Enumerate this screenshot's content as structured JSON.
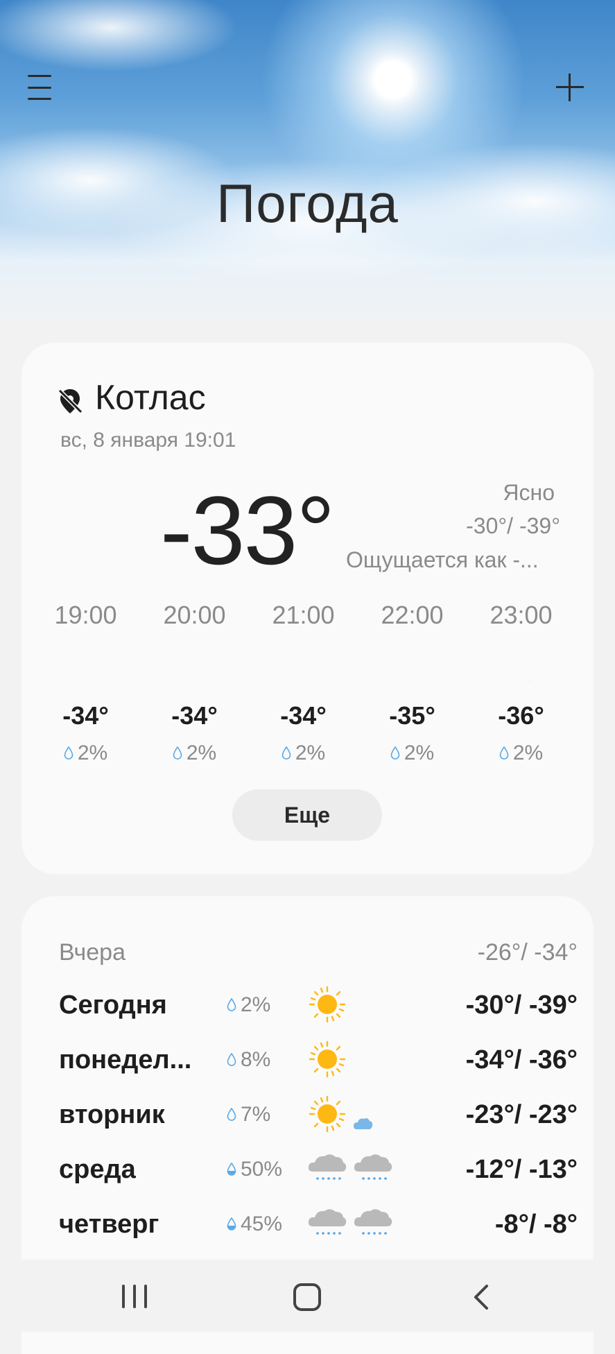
{
  "header": {
    "title": "Погода",
    "menu_icon": "hamburger-menu-icon",
    "add_icon": "plus-icon"
  },
  "colors": {
    "accent_yellow": "#fdb813",
    "drop_blue": "#5aa9e6",
    "text_dark": "#1e1e1e",
    "text_gray": "#8a8a8a"
  },
  "current": {
    "city": "Котлас",
    "location_icon": "location-off-icon",
    "datetime": "вс, 8 января 19:01",
    "temperature": "-33°",
    "condition": "Ясно",
    "hi_lo": "-30°/ -39°",
    "feels_like": "Ощущается как -...",
    "condition_icon": "moon-icon"
  },
  "hourly": [
    {
      "time": "19:00",
      "temp": "-34°",
      "precip": "2%",
      "icon": "moon-icon"
    },
    {
      "time": "20:00",
      "temp": "-34°",
      "precip": "2%",
      "icon": "moon-icon"
    },
    {
      "time": "21:00",
      "temp": "-34°",
      "precip": "2%",
      "icon": "moon-icon"
    },
    {
      "time": "22:00",
      "temp": "-35°",
      "precip": "2%",
      "icon": "moon-icon"
    },
    {
      "time": "23:00",
      "temp": "-36°",
      "precip": "2%",
      "icon": "moon-icon"
    }
  ],
  "more_label": "Еще",
  "daily": {
    "yesterday": {
      "label": "Вчера",
      "range": "-26°/ -34°"
    },
    "days": [
      {
        "day": "Сегодня",
        "precip": "2%",
        "day_icon": "sun-icon",
        "night_icon": "moon-icon",
        "range": "-30°/ -39°"
      },
      {
        "day": "понедел...",
        "precip": "8%",
        "day_icon": "sun-icon",
        "night_icon": "moon-icon",
        "range": "-34°/ -36°"
      },
      {
        "day": "вторник",
        "precip": "7%",
        "day_icon": "sun-icon",
        "night_icon": "moon-cloud-icon",
        "range": "-23°/ -23°"
      },
      {
        "day": "среда",
        "precip": "50%",
        "day_icon": "snow-cloud-icon",
        "night_icon": "snow-cloud-icon",
        "range": "-12°/ -13°"
      },
      {
        "day": "четверг",
        "precip": "45%",
        "day_icon": "snow-cloud-icon",
        "night_icon": "snow-cloud-icon",
        "range": "-8°/ -8°"
      }
    ]
  },
  "navbar": {
    "recent_icon": "recent-apps-icon",
    "home_icon": "home-icon",
    "back_icon": "back-icon"
  }
}
